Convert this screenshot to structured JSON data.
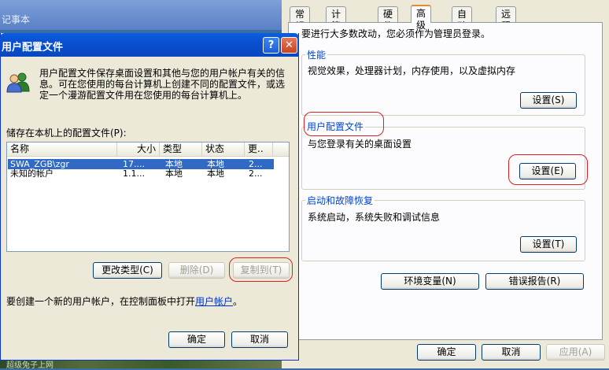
{
  "notepad": {
    "title": "记事本"
  },
  "desktop": {
    "watermark": "超级兔子上网"
  },
  "system_properties": {
    "tabs": [
      {
        "label": "常规"
      },
      {
        "label": "计算机名"
      },
      {
        "label": "硬件"
      },
      {
        "label": "高级"
      },
      {
        "label": "自动更新"
      },
      {
        "label": "远程"
      }
    ],
    "active_tab": "高级",
    "admin_note": "要进行大多数改动，您必须作为管理员登录。",
    "performance": {
      "title": "性能",
      "description": "视觉效果，处理器计划，内存使用，以及虚拟内存",
      "settings_label": "设置(S)"
    },
    "user_profiles": {
      "title": "用户配置文件",
      "description": "与您登录有关的桌面设置",
      "settings_label": "设置(E)"
    },
    "startup_recovery": {
      "title": "启动和故障恢复",
      "description": "系统启动，系统失败和调试信息",
      "settings_label": "设置(T)"
    },
    "env_vars_label": "环境变量(N)",
    "error_report_label": "错误报告(R)",
    "ok_label": "确定",
    "cancel_label": "取消",
    "apply_label": "应用(A)"
  },
  "user_profiles_dialog": {
    "title": "用户配置文件",
    "help_glyph": "?",
    "close_glyph": "✕",
    "intro": "用户配置文件保存桌面设置和其他与您的用户帐户有关的信息。可在您使用的每台计算机上创建不同的配置文件，或选定一个漫游配置文件用在您使用的每台计算机上。",
    "stored_label": "储存在本机上的配置文件(P):",
    "columns": [
      "名称",
      "大小",
      "类型",
      "状态",
      "更.."
    ],
    "rows": [
      {
        "name": "SWA_ZGB\\zgr",
        "size": "17....",
        "type": "本地",
        "status": "本地",
        "modified": "2...",
        "selected": true
      },
      {
        "name": "未知的帐户",
        "size": "1.1...",
        "type": "本地",
        "status": "本地",
        "modified": "2...",
        "selected": false
      }
    ],
    "change_type_label": "更改类型(C)",
    "delete_label": "删除(D)",
    "copy_to_label": "复制到(T)",
    "footer_text": "要创建一个新的用户帐户，在控制面板中打开",
    "footer_link": "用户帐户",
    "footer_end": "。",
    "ok_label": "确定",
    "cancel_label": "取消"
  },
  "colors": {
    "accent_title": "#0046d5",
    "highlight_oval": "#e02020",
    "selection": "#316ac5"
  }
}
